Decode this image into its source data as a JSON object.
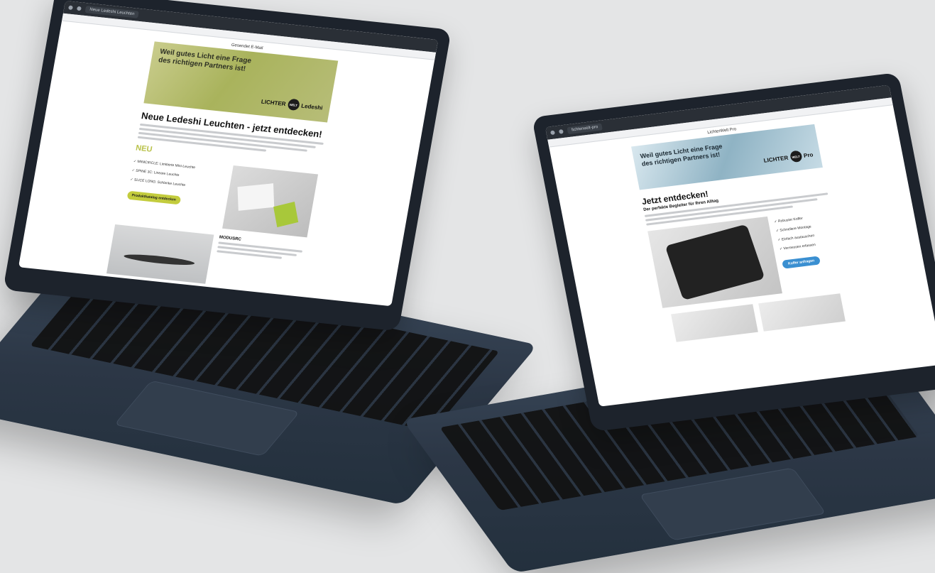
{
  "laptop1": {
    "browser_tab": "Neue Ledeshi Leuchten",
    "preheader": "Gesendet E-Mail",
    "banner_text": "Weil gutes Licht eine Frage des richtigen Partners ist!",
    "logo_word": "LICHTER",
    "logo_badge": "WELT",
    "logo_suffix": "Ledeshi",
    "headline": "Neue Ledeshi Leuchten - jetzt entdecken!",
    "new_label": "NEU",
    "bullets": [
      "✓ MINICIRCLE: Limitierte Mini-Leuchte",
      "✓ SPINE 3C: Lineare Leuchte",
      "✓ SLICE LONG: Schlanke Leuchte"
    ],
    "cta": "Produktkatalog entdecken",
    "product2_title": "MODUSRC",
    "accent_color": "#c3cc3d"
  },
  "laptop2": {
    "browser_tab": "lichterwelt-pro",
    "preheader": "LichterWelt Pro",
    "banner_text": "Weil gutes Licht eine Frage des richtigen Partners ist!",
    "logo_word": "LICHTER",
    "logo_badge": "WELT",
    "logo_suffix": "Pro",
    "headline": "Jetzt entdecken!",
    "subheadline": "Der perfekte Begleiter für Ihren Alltag",
    "checks": [
      "✓ Robuster Koffer",
      "✓ Schnellere Montage",
      "✓ Einfach austauschen",
      "✓ Vermessen erfassen"
    ],
    "cta": "Koffer anfragen",
    "accent_color": "#3a8fd1"
  }
}
